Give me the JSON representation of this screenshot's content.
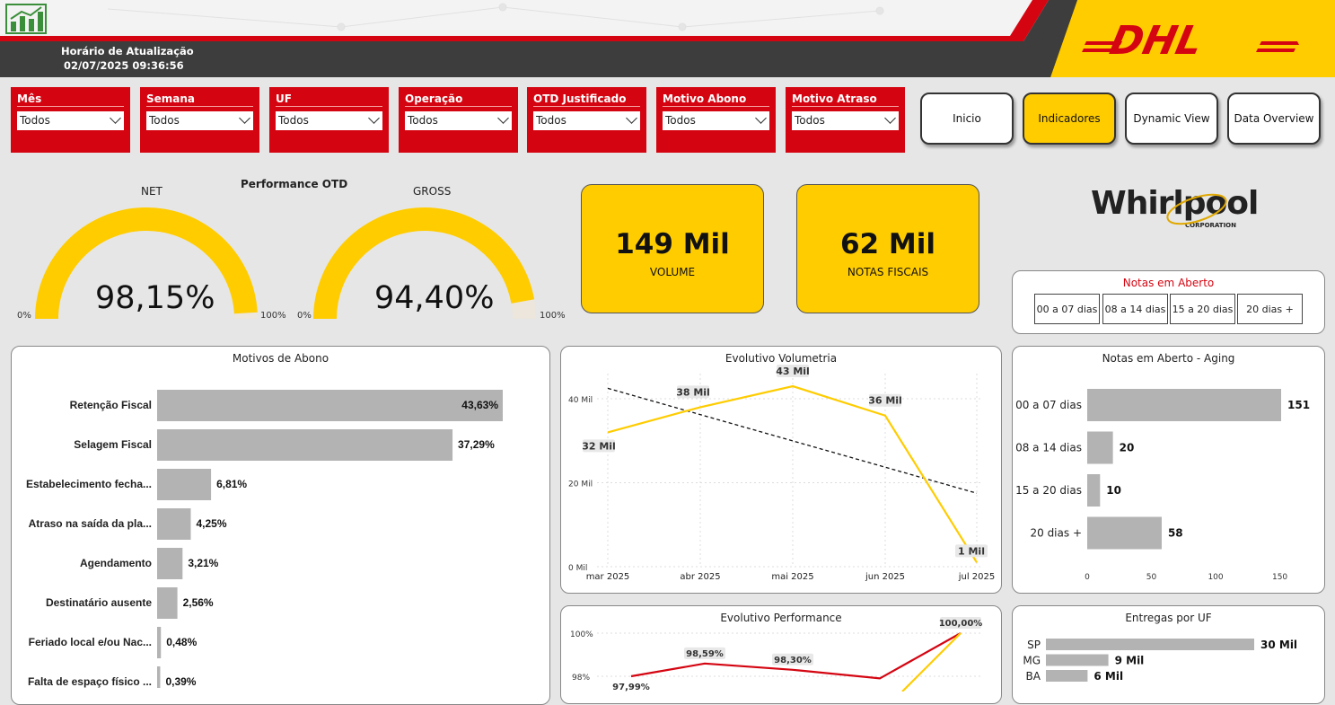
{
  "header": {
    "update_label": "Horário de Atualização",
    "update_time": "02/07/2025 09:36:56",
    "app_icon": "chart-icon",
    "brand_logo": "DHL"
  },
  "slicers": [
    {
      "label": "Mês",
      "value": "Todos"
    },
    {
      "label": "Semana",
      "value": "Todos"
    },
    {
      "label": "UF",
      "value": "Todos"
    },
    {
      "label": "Operação",
      "value": "Todos"
    },
    {
      "label": "OTD Justificado",
      "value": "Todos"
    },
    {
      "label": "Motivo Abono",
      "value": "Todos"
    },
    {
      "label": "Motivo Atraso",
      "value": "Todos"
    }
  ],
  "nav": {
    "inicio": "Inicio",
    "indicadores": "Indicadores",
    "dynamic": "Dynamic View",
    "overview": "Data Overview",
    "active": "Indicadores"
  },
  "performance": {
    "title": "Performance OTD",
    "net": {
      "label": "NET",
      "value": "98,15%",
      "fraction": 0.9815,
      "min": "0%",
      "max": "100%"
    },
    "gross": {
      "label": "GROSS",
      "value": "94,40%",
      "fraction": 0.944,
      "min": "0%",
      "max": "100%"
    }
  },
  "kpis": {
    "volume": {
      "value": "149 Mil",
      "label": "VOLUME"
    },
    "notas": {
      "value": "62 Mil",
      "label": "NOTAS FISCAIS"
    }
  },
  "client_logo": {
    "name": "Whirlpool",
    "sub": "CORPORATION"
  },
  "notas_aberto": {
    "title": "Notas em Aberto",
    "buckets": [
      "00 a 07 dias",
      "08 a 14 dias",
      "15 a 20 dias",
      "20 dias +"
    ]
  },
  "colors": {
    "red": "#d40511",
    "yellow": "#ffcc00",
    "bar_gray": "#b3b3b3"
  },
  "chart_data": [
    {
      "type": "bar",
      "title": "Motivos de Abono",
      "orientation": "horizontal",
      "categories": [
        "Retenção Fiscal",
        "Selagem Fiscal",
        "Estabelecimento fecha...",
        "Atraso na saída da pla...",
        "Agendamento",
        "Destinatário ausente",
        "Feriado local e/ou Nac...",
        "Falta de espaço físico ..."
      ],
      "values": [
        43.63,
        37.29,
        6.81,
        4.25,
        3.21,
        2.56,
        0.48,
        0.39
      ],
      "labels": [
        "43,63%",
        "37,29%",
        "6,81%",
        "4,25%",
        "3,21%",
        "2,56%",
        "0,48%",
        "0,39%"
      ]
    },
    {
      "type": "line",
      "title": "Evolutivo Volumetria",
      "x": [
        "mar 2025",
        "abr 2025",
        "mai 2025",
        "jun 2025",
        "jul 2025"
      ],
      "series": [
        {
          "values": [
            32,
            38,
            43,
            36,
            1
          ],
          "labels": [
            "32 Mil",
            "38 Mil",
            "43 Mil",
            "36 Mil",
            "1 Mil"
          ]
        }
      ],
      "trend": [
        42.5,
        17.5
      ],
      "yticks": [
        "0 Mil",
        "20 Mil",
        "40 Mil"
      ],
      "ylim": [
        0,
        46
      ]
    },
    {
      "type": "bar",
      "title": "Notas em Aberto - Aging",
      "orientation": "horizontal",
      "categories": [
        "00 a 07 dias",
        "08 a 14 dias",
        "15 a 20 dias",
        "20 dias +"
      ],
      "values": [
        151,
        20,
        10,
        58
      ],
      "xticks": [
        "0",
        "50",
        "100",
        "150"
      ],
      "xlim": [
        0,
        151
      ]
    },
    {
      "type": "line",
      "title": "Evolutivo Performance",
      "yticks": [
        "100%",
        "98%"
      ],
      "series": [
        {
          "values": [
            98.0,
            98.59,
            98.3,
            97.9,
            100.0
          ],
          "labels": [
            "",
            "98,59%",
            "98,30%",
            "",
            "100,00%"
          ]
        }
      ],
      "partial_label": "97,99%"
    },
    {
      "type": "bar",
      "title": "Entregas por UF",
      "orientation": "horizontal",
      "categories": [
        "SP",
        "MG",
        "BA"
      ],
      "values": [
        30,
        9,
        6
      ],
      "labels": [
        "30 Mil",
        "9 Mil",
        "6 Mil"
      ]
    }
  ]
}
